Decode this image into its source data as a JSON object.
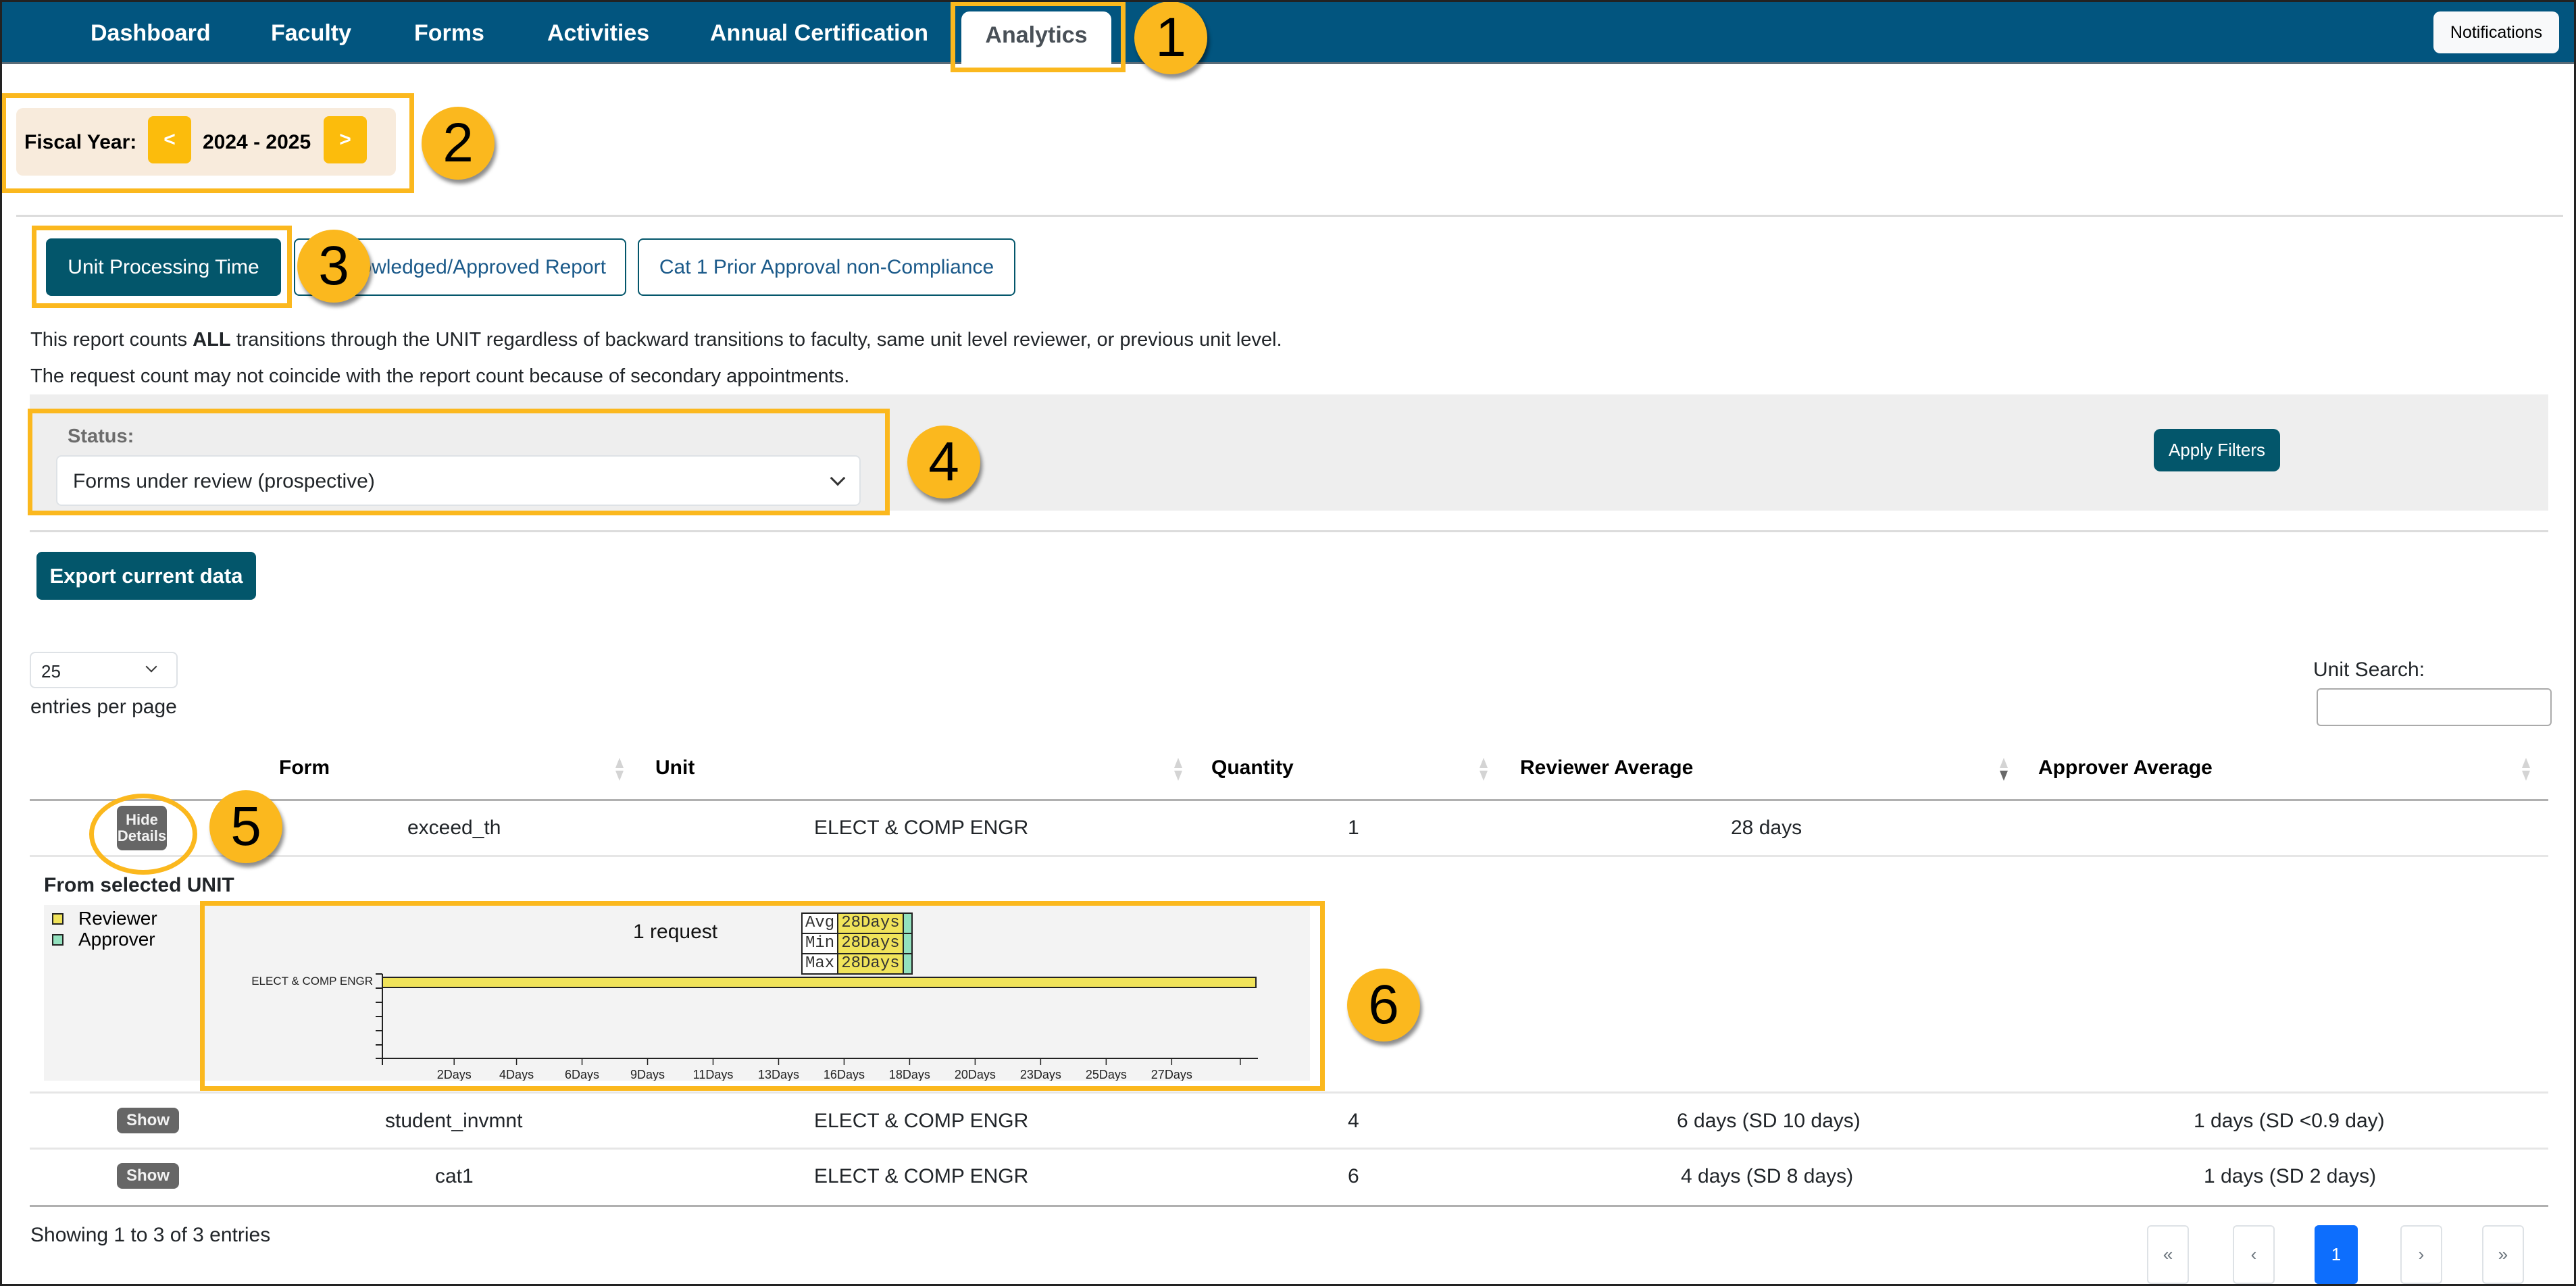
{
  "nav": {
    "items": [
      "Dashboard",
      "Faculty",
      "Forms",
      "Activities",
      "Annual Certification"
    ],
    "active": "Analytics",
    "notifications_label": "Notifications"
  },
  "fiscal_year": {
    "label": "Fiscal Year:",
    "prev": "<",
    "next": ">",
    "value": "2024 - 2025"
  },
  "report_tabs": [
    {
      "label": "Unit Processing Time",
      "active": true
    },
    {
      "label": "Acknowledged/Approved Report",
      "active": false
    },
    {
      "label": "Cat 1 Prior Approval non-Compliance",
      "active": false
    }
  ],
  "description": {
    "line1_pre": "This report counts ",
    "line1_bold": "ALL",
    "line1_post": " transitions through the UNIT regardless of backward transitions to faculty, same unit level reviewer, or previous unit level.",
    "line2": "The request count may not coincide with the report count because of secondary appointments."
  },
  "filters": {
    "status_label": "Status:",
    "status_value": "Forms under review (prospective)",
    "apply_label": "Apply Filters"
  },
  "export_label": "Export current data",
  "entries": {
    "value": "25",
    "label": "entries per page"
  },
  "search": {
    "label": "Unit Search:",
    "value": "",
    "placeholder": ""
  },
  "table": {
    "headers": [
      "Form",
      "Unit",
      "Quantity",
      "Reviewer Average",
      "Approver Average"
    ],
    "sorted_column": "Reviewer Average",
    "sort_direction": "descending",
    "rows": [
      {
        "toggle": "Hide Details",
        "form": "exceed_th",
        "unit": "ELECT & COMP ENGR",
        "quantity": "1",
        "reviewer_avg": "28 days",
        "approver_avg": ""
      },
      {
        "toggle": "Show",
        "form": "student_invmnt",
        "unit": "ELECT & COMP ENGR",
        "quantity": "4",
        "reviewer_avg": "6 days (SD 10 days)",
        "approver_avg": "1 days (SD <0.9 day)"
      },
      {
        "toggle": "Show",
        "form": "cat1",
        "unit": "ELECT & COMP ENGR",
        "quantity": "6",
        "reviewer_avg": "4 days (SD 8 days)",
        "approver_avg": "1 days (SD 2 days)"
      }
    ]
  },
  "details": {
    "title": "From selected UNIT",
    "legend": [
      {
        "name": "Reviewer",
        "color": "#f0e35a"
      },
      {
        "name": "Approver",
        "color": "#93e1be"
      }
    ],
    "request_count_label": "1 request",
    "stats": [
      {
        "key": "Avg",
        "reviewer": "28Days"
      },
      {
        "key": "Min",
        "reviewer": "28Days"
      },
      {
        "key": "Max",
        "reviewer": "28Days"
      }
    ]
  },
  "chart_data": {
    "type": "bar",
    "orientation": "horizontal",
    "title": "1 request",
    "categories": [
      "ELECT & COMP ENGR"
    ],
    "series": [
      {
        "name": "Reviewer",
        "color": "#f0e35a",
        "values": [
          28
        ]
      },
      {
        "name": "Approver",
        "color": "#93e1be",
        "values": [
          0
        ]
      }
    ],
    "xlabel": "",
    "ylabel": "",
    "x_ticks": [
      2.3,
      4.3,
      6.4,
      8.5,
      10.6,
      12.7,
      14.8,
      16.9,
      19.0,
      21.1,
      23.2,
      25.3,
      27.5
    ],
    "x_tick_labels": [
      "2Days",
      "4Days",
      "6Days",
      "9Days",
      "11Days",
      "13Days",
      "16Days",
      "18Days",
      "20Days",
      "23Days",
      "25Days",
      "27Days"
    ],
    "xlim": [
      0,
      28
    ],
    "legend": "left"
  },
  "footer": {
    "showing": "Showing 1 to 3 of 3 entries"
  },
  "pagination": {
    "first": "«",
    "prev": "‹",
    "current": "1",
    "next": "›",
    "last": "»"
  },
  "callouts": [
    "1",
    "2",
    "3",
    "4",
    "5",
    "6"
  ],
  "colors": {
    "nav_bg": "#02557f",
    "primary": "#03566b",
    "callout": "#fbb81e",
    "page_active": "#0d6efd"
  }
}
